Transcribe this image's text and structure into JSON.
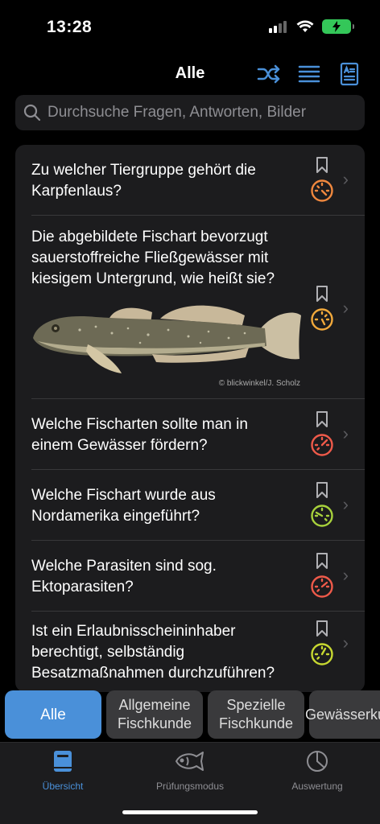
{
  "status": {
    "time": "13:28"
  },
  "nav": {
    "title": "Alle"
  },
  "search": {
    "placeholder": "Durchsuche Fragen, Antworten, Bilder"
  },
  "questions": [
    {
      "text": "Zu welcher Tiergruppe gehört die Karpfenlaus?",
      "gauge_color": "#f0883e"
    },
    {
      "text": "Die abgebildete Fischart bevorzugt sauerstoffreiche Fließgewässer mit kiesigem Untergrund, wie heißt sie?",
      "gauge_color": "#f2a93b",
      "image_credit": "© blickwinkel/J. Scholz"
    },
    {
      "text": "Welche Fischarten sollte man in einem Gewässer fördern?",
      "gauge_color": "#ef5a4a"
    },
    {
      "text": "Welche Fischart wurde aus Nordamerika eingeführt?",
      "gauge_color": "#a8d23c"
    },
    {
      "text": "Welche Parasiten sind sog. Ektoparasiten?",
      "gauge_color": "#ef5a4a"
    },
    {
      "text": "Ist ein Erlaubnisscheininhaber berechtigt, selbständig Besatzmaßnahmen durchzuführen?",
      "gauge_color": "#c7d831"
    }
  ],
  "chips": [
    {
      "label": "Alle"
    },
    {
      "label": "Allgemeine Fischkunde"
    },
    {
      "label": "Spezielle Fischkunde"
    },
    {
      "label": "Gewässerkunde"
    }
  ],
  "tabs": [
    {
      "label": "Übersicht"
    },
    {
      "label": "Prüfungsmodus"
    },
    {
      "label": "Auswertung"
    }
  ],
  "colors": {
    "accent": "#4a90d9",
    "background": "#000000",
    "card": "#1c1c1e"
  }
}
